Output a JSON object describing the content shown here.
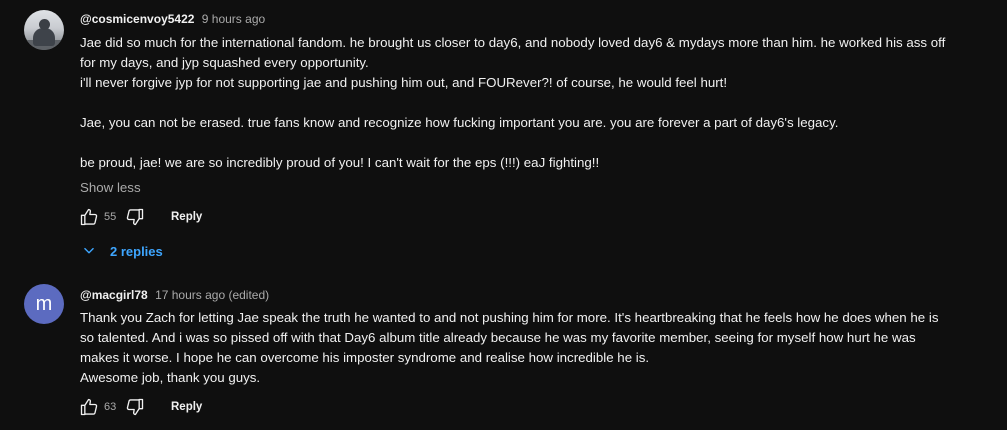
{
  "comments": [
    {
      "author": "@cosmicenvoy5422",
      "time": "9 hours ago",
      "paragraphs": [
        "Jae did so much for the international fandom. he brought us closer to day6, and nobody loved day6 & mydays more than him. he worked his ass off",
        "for my days, and jyp squashed every opportunity.",
        "i'll never forgive jyp for not supporting jae and pushing him out, and FOURever?! of course, he would feel hurt!",
        "Jae, you can not be erased. true fans know and recognize how fucking important you are. you are forever a part of day6's legacy.",
        "be proud, jae! we are so incredibly proud of you! I can't wait for the eps (!!!) eaJ fighting!!"
      ],
      "show_less": "Show less",
      "likes": "55",
      "reply_label": "Reply",
      "replies_label": "2 replies",
      "avatar_icon": "profile-photo"
    },
    {
      "author": "@macgirl78",
      "time": "17 hours ago (edited)",
      "avatar_letter": "m",
      "avatar_color": "#5c6bc0",
      "paragraphs": [
        "Thank you Zach for letting Jae speak the truth he wanted to and not pushing him for more. It's heartbreaking that he feels how he does when he is",
        "so talented. And i was so pissed off with that Day6 album title already because he was my favorite member, seeing for myself how hurt he was",
        "makes it worse. I hope he can overcome his imposter syndrome and realise how incredible he is.",
        "Awesome job, thank you guys."
      ],
      "likes": "63",
      "reply_label": "Reply"
    }
  ],
  "icons": {
    "like": "thumbs-up-icon",
    "dislike": "thumbs-down-icon",
    "expand": "chevron-down-icon"
  },
  "colors": {
    "background": "#0f0f0f",
    "link": "#3ea6ff",
    "secondary_text": "#aaaaaa"
  }
}
